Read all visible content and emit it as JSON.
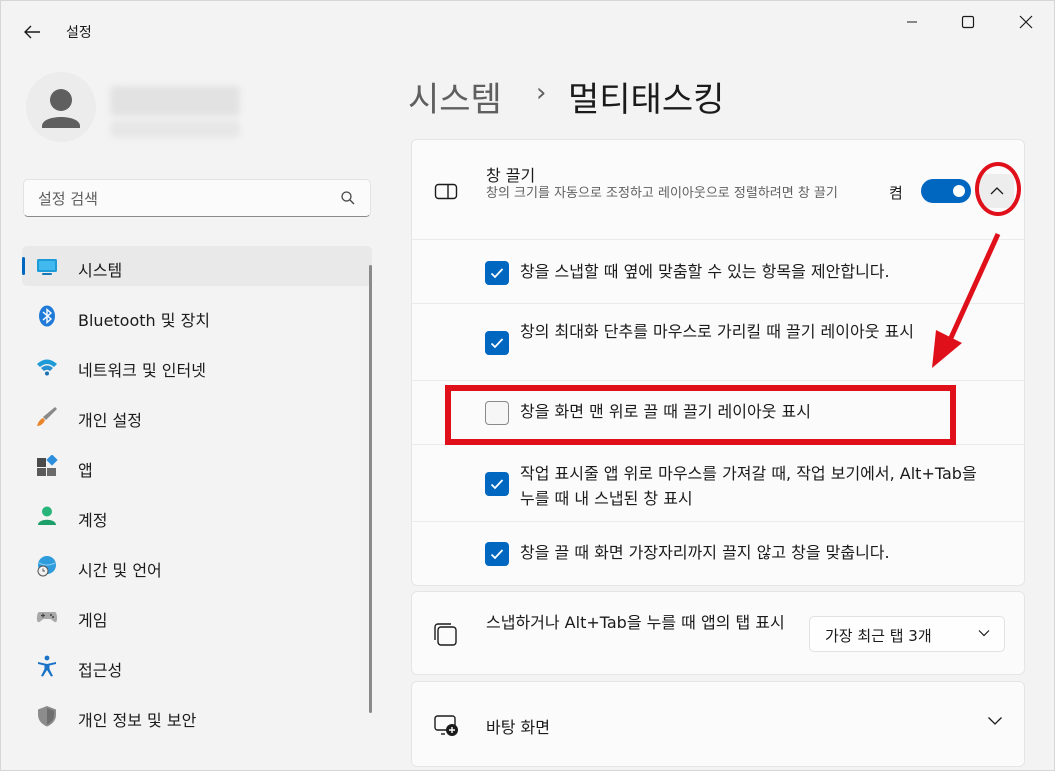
{
  "window": {
    "title": "설정"
  },
  "search": {
    "placeholder": "설정 검색"
  },
  "sidebar": {
    "items": [
      {
        "label": "시스템",
        "icon": "system-icon"
      },
      {
        "label": "Bluetooth 및 장치",
        "icon": "bluetooth-icon"
      },
      {
        "label": "네트워크 및 인터넷",
        "icon": "wifi-icon"
      },
      {
        "label": "개인 설정",
        "icon": "brush-icon"
      },
      {
        "label": "앱",
        "icon": "apps-icon"
      },
      {
        "label": "계정",
        "icon": "person-icon"
      },
      {
        "label": "시간 및 언어",
        "icon": "globe-clock-icon"
      },
      {
        "label": "게임",
        "icon": "gamepad-icon"
      },
      {
        "label": "접근성",
        "icon": "accessibility-icon"
      },
      {
        "label": "개인 정보 및 보안",
        "icon": "shield-icon"
      }
    ]
  },
  "breadcrumb": {
    "parent": "시스템",
    "separator": "›",
    "current": "멀티태스킹"
  },
  "snap": {
    "title": "창 끌기",
    "description": "창의 크기를 자동으로 조정하고 레이아웃으로 정렬하려면 창 끌기",
    "toggle_label": "켬",
    "toggle_on": true,
    "options": [
      {
        "text": "창을 스냅할 때 옆에 맞춤할 수 있는 항목을 제안합니다.",
        "checked": true
      },
      {
        "text": "창의 최대화 단추를 마우스로 가리킬 때 끌기 레이아웃 표시",
        "checked": true
      },
      {
        "text": "창을 화면 맨 위로 끌 때 끌기 레이아웃 표시",
        "checked": false
      },
      {
        "text": "작업 표시줄 앱 위로 마우스를 가져갈 때, 작업 보기에서, Alt+Tab을 누를 때 내 스냅된 창 표시",
        "checked": true
      },
      {
        "text": "창을 끌 때 화면 가장자리까지 끌지 않고 창을 맞춥니다.",
        "checked": true
      }
    ]
  },
  "alt_tab": {
    "label": "스냅하거나 Alt+Tab을 누를 때 앱의 탭 표시",
    "dropdown_value": "가장 최근 탭 3개"
  },
  "desktops": {
    "label": "바탕 화면"
  },
  "colors": {
    "accent": "#0067c0",
    "annotation": "#e0101b"
  }
}
